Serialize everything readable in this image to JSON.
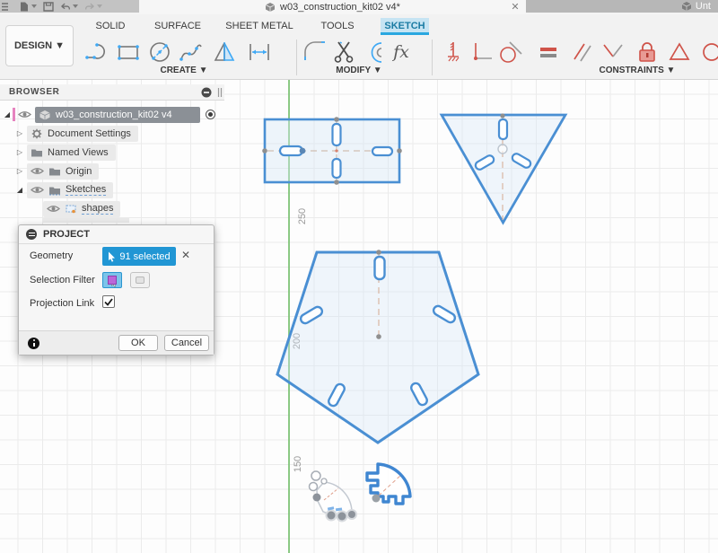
{
  "titlebar": {
    "document_tab": "w03_construction_kit02 v4*",
    "secondary_tab": "Unt",
    "close_glyph": "✕",
    "window_icons": [
      "menu-icon",
      "new-file-icon",
      "save-icon",
      "undo-icon",
      "redo-icon"
    ]
  },
  "ribbon": {
    "design_label": "DESIGN ▼",
    "tabs": [
      "SOLID",
      "SURFACE",
      "SHEET METAL",
      "TOOLS",
      "SKETCH"
    ],
    "active_tab": "SKETCH",
    "fx_glyph": "fx",
    "groups": [
      {
        "label": "CREATE ▼",
        "tools": [
          "two-point-arc",
          "rectangle",
          "circle-diameter",
          "spline",
          "mirror-polygon",
          "sketch-dimension"
        ]
      },
      {
        "label": "MODIFY ▼",
        "tools": [
          "fillet",
          "trim",
          "offset",
          "change-parameters"
        ]
      },
      {
        "label": "CONSTRAINTS ▼",
        "tools": [
          "coincident",
          "perpendicular",
          "tangent",
          "equal",
          "parallel",
          "midpoint",
          "fix-lock",
          "polygon",
          "concentric"
        ]
      }
    ]
  },
  "browser": {
    "title": "BROWSER",
    "root_label": "w03_construction_kit02 v4",
    "items": [
      {
        "label": "Document Settings"
      },
      {
        "label": "Named Views"
      },
      {
        "label": "Origin"
      },
      {
        "label": "Sketches"
      },
      {
        "label": "shapes"
      }
    ]
  },
  "canvas": {
    "axis_labels": [
      {
        "text": "250"
      },
      {
        "text": "200"
      },
      {
        "text": "150"
      }
    ]
  },
  "dialog": {
    "title": "PROJECT",
    "geometry_label": "Geometry",
    "geometry_value": "91 selected",
    "remove_glyph": "✕",
    "selection_filter_label": "Selection Filter",
    "projection_link_label": "Projection Link",
    "ok_label": "OK",
    "cancel_label": "Cancel"
  },
  "colors": {
    "accent_blue": "#2196d4",
    "sketch_blue": "#4a8fd3",
    "constraint_red": "#cf5349",
    "axis_green": "#79c271",
    "tab_highlight": "#c6e4f3"
  }
}
